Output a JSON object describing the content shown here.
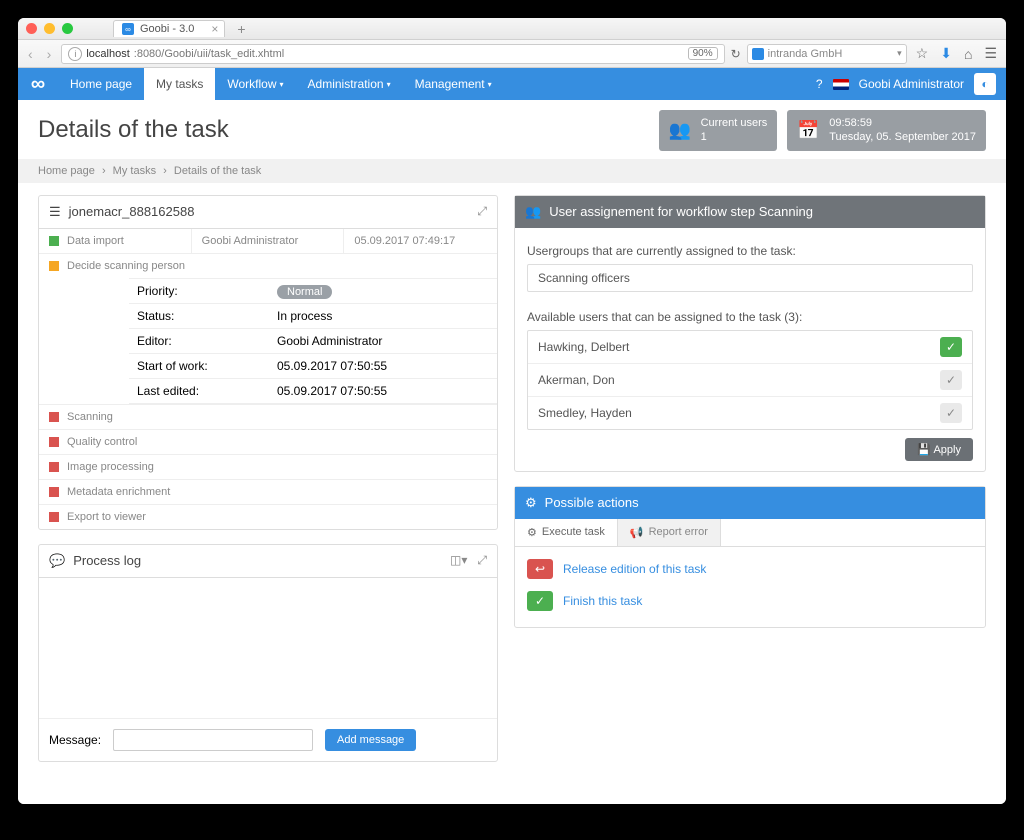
{
  "browser": {
    "tab_title": "Goobi - 3.0",
    "url_host": "localhost",
    "url_path": ":8080/Goobi/uii/task_edit.xhtml",
    "zoom": "90%",
    "search_placeholder": "intranda GmbH"
  },
  "nav": {
    "home": "Home page",
    "mytasks": "My tasks",
    "workflow": "Workflow",
    "admin": "Administration",
    "mgmt": "Management",
    "user": "Goobi Administrator"
  },
  "header": {
    "title": "Details of the task",
    "users_label": "Current users",
    "users_count": "1",
    "time": "09:58:59",
    "date": "Tuesday, 05. September 2017"
  },
  "breadcrumbs": {
    "a": "Home page",
    "b": "My tasks",
    "c": "Details of the task"
  },
  "task": {
    "id": "jonemacr_888162588",
    "row1_name": "Data import",
    "row1_user": "Goobi Administrator",
    "row1_date": "05.09.2017 07:49:17",
    "row2_name": "Decide scanning person",
    "details": {
      "priority_k": "Priority:",
      "priority_v": "Normal",
      "status_k": "Status:",
      "status_v": "In process",
      "editor_k": "Editor:",
      "editor_v": "Goobi Administrator",
      "start_k": "Start of work:",
      "start_v": "05.09.2017 07:50:55",
      "edited_k": "Last edited:",
      "edited_v": "05.09.2017 07:50:55"
    },
    "s3": "Scanning",
    "s4": "Quality control",
    "s5": "Image processing",
    "s6": "Metadata enrichment",
    "s7": "Export to viewer"
  },
  "log": {
    "title": "Process log",
    "msg_label": "Message:",
    "add_btn": "Add message"
  },
  "assign": {
    "title": "User assignement for workflow step Scanning",
    "groups_label": "Usergroups that are currently assigned to the task:",
    "group1": "Scanning officers",
    "users_label": "Available users that can be assigned to the task (3):",
    "u1": "Hawking, Delbert",
    "u2": "Akerman, Don",
    "u3": "Smedley, Hayden",
    "apply": "Apply"
  },
  "actions": {
    "title": "Possible actions",
    "tab_exec": "Execute task",
    "tab_err": "Report error",
    "release": "Release edition of this task",
    "finish": "Finish this task"
  }
}
